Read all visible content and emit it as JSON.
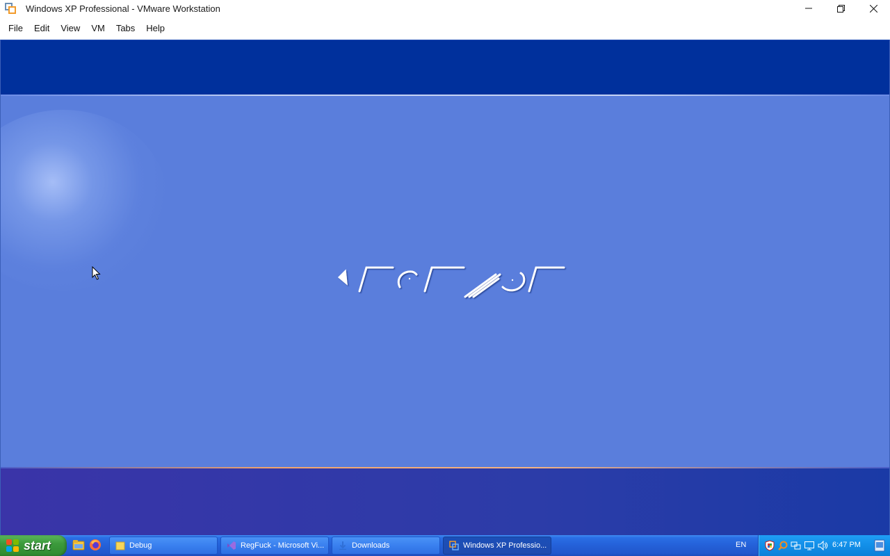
{
  "window": {
    "title": "Windows XP Professional - VMware Workstation",
    "controls": {
      "minimize": "—",
      "restore": "❐",
      "close": "✕"
    }
  },
  "menu": {
    "items": [
      "File",
      "Edit",
      "View",
      "VM",
      "Tabs",
      "Help"
    ]
  },
  "guest": {
    "screen": "Welcome screen (XP login) with stylized glyph text",
    "colors": {
      "top_band": "#00309c",
      "main": "#5a7edc",
      "bottom_band": "#2c3ca8"
    }
  },
  "taskbar": {
    "start_label": "start",
    "quick_launch_icons": [
      "explorer-icon",
      "firefox-icon"
    ],
    "tasks": [
      {
        "label": "Debug",
        "icon": "folder-icon",
        "active": false
      },
      {
        "label": "RegFuck - Microsoft Vi...",
        "icon": "visual-studio-icon",
        "active": false
      },
      {
        "label": "Downloads",
        "icon": "download-icon",
        "active": false
      },
      {
        "label": "Windows XP Professio...",
        "icon": "vmware-icon",
        "active": true
      }
    ],
    "language": "EN",
    "tray_icons": [
      "security-shield-icon",
      "search-icon",
      "network-icon",
      "monitor-icon",
      "volume-icon"
    ],
    "clock": "6:47 PM"
  }
}
